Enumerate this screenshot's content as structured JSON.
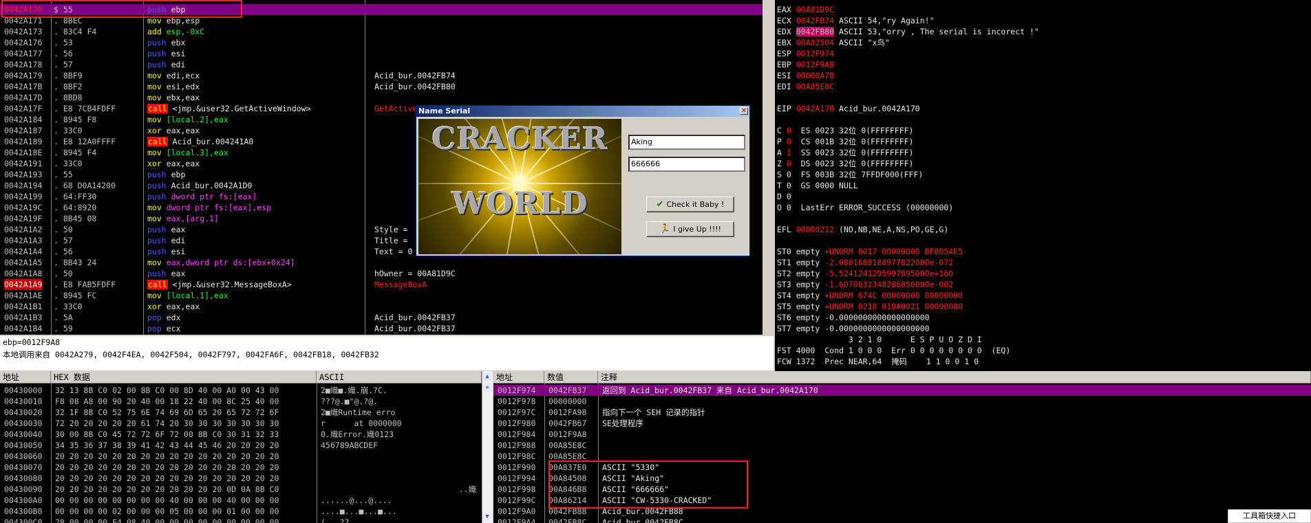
{
  "disasm": {
    "rows": [
      {
        "addr": "0042A170",
        "hex": "$ 55",
        "code": "push ebp",
        "cmt": ""
      },
      {
        "addr": "0042A171",
        "hex": ". 8BEC",
        "code": "mov ebp,esp",
        "cmt": ""
      },
      {
        "addr": "0042A173",
        "hex": ". 83C4 F4",
        "code": "add esp,-0xC",
        "cmt": ""
      },
      {
        "addr": "0042A176",
        "hex": ". 53",
        "code": "push ebx",
        "cmt": ""
      },
      {
        "addr": "0042A177",
        "hex": ". 56",
        "code": "push esi",
        "cmt": ""
      },
      {
        "addr": "0042A178",
        "hex": ". 57",
        "code": "push edi",
        "cmt": ""
      },
      {
        "addr": "0042A179",
        "hex": ". 8BF9",
        "code": "mov edi,ecx",
        "cmt": "Acid_bur.0042FB74"
      },
      {
        "addr": "0042A17B",
        "hex": ". 8BF2",
        "code": "mov esi,edx",
        "cmt": "Acid_bur.0042FB80"
      },
      {
        "addr": "0042A17D",
        "hex": ". 8BD8",
        "code": "mov ebx,eax",
        "cmt": ""
      },
      {
        "addr": "0042A17F",
        "hex": ". E8 7CB4FDFF",
        "code": "call <jmp.&user32.GetActiveWindow>",
        "cmt": "GetActiveWindow"
      },
      {
        "addr": "0042A184",
        "hex": ". 8945 F8",
        "code": "mov [local.2],eax",
        "cmt": ""
      },
      {
        "addr": "0042A187",
        "hex": ". 33C0",
        "code": "xor eax,eax",
        "cmt": ""
      },
      {
        "addr": "0042A189",
        "hex": ". E8 12A0FFFF",
        "code": "call Acid_bur.004241A0",
        "cmt": ""
      },
      {
        "addr": "0042A18E",
        "hex": ". 8945 F4",
        "code": "mov [local.3],eax",
        "cmt": ""
      },
      {
        "addr": "0042A191",
        "hex": ". 33C0",
        "code": "xor eax,eax",
        "cmt": ""
      },
      {
        "addr": "0042A193",
        "hex": ". 55",
        "code": "push ebp",
        "cmt": ""
      },
      {
        "addr": "0042A194",
        "hex": ". 68 D0A14200",
        "code": "push Acid_bur.0042A1D0",
        "cmt": ""
      },
      {
        "addr": "0042A199",
        "hex": ". 64:FF30",
        "code": "push dword ptr fs:[eax]",
        "cmt": ""
      },
      {
        "addr": "0042A19C",
        "hex": ". 64:8920",
        "code": "mov dword ptr fs:[eax],esp",
        "cmt": ""
      },
      {
        "addr": "0042A19F",
        "hex": ". 8B45 08",
        "code": "mov eax,[arg.1]",
        "cmt": ""
      },
      {
        "addr": "0042A1A2",
        "hex": ". 50",
        "code": "push eax",
        "cmt": "Style ="
      },
      {
        "addr": "0042A1A3",
        "hex": ". 57",
        "code": "push edi",
        "cmt": "Title ="
      },
      {
        "addr": "0042A1A4",
        "hex": ". 56",
        "code": "push esi",
        "cmt": "Text = 0"
      },
      {
        "addr": "0042A1A5",
        "hex": ". 8B43 24",
        "code": "mov eax,dword ptr ds:[ebx+0x24]",
        "cmt": ""
      },
      {
        "addr": "0042A1A8",
        "hex": ". 50",
        "code": "push eax",
        "cmt": "hOwner = 00A81D9C"
      },
      {
        "addr": "0042A1A9",
        "hex": ". E8 FAB5FDFF",
        "code": "call <jmp.&user32.MessageBoxA>",
        "cmt": "MessageBoxA"
      },
      {
        "addr": "0042A1AE",
        "hex": ". 8945 FC",
        "code": "mov [local.1],eax",
        "cmt": ""
      },
      {
        "addr": "0042A1B1",
        "hex": ". 33C0",
        "code": "xor eax,eax",
        "cmt": ""
      },
      {
        "addr": "0042A1B3",
        "hex": ". 5A",
        "code": "pop edx",
        "cmt": "Acid_bur.0042FB37"
      },
      {
        "addr": "0042A1B4",
        "hex": ". 59",
        "code": "pop ecx",
        "cmt": "Acid_bur.0042FB37"
      }
    ]
  },
  "info": {
    "line1": "ebp=0012F9A8",
    "line2": "本地调用来自 0042A279, 0042F4EA, 0042F504, 0042F797, 0042FA6F, 0042FB18, 0042FB32"
  },
  "registers": {
    "gp": [
      {
        "name": "EAX",
        "val": "00A81D9C",
        "note": ""
      },
      {
        "name": "ECX",
        "val": "0042FB74",
        "note": "ASCII 54,\"ry Again!\""
      },
      {
        "name": "EDX",
        "val": "0042FB80",
        "note": "ASCII 53,\"orry , The serial is incorect !\""
      },
      {
        "name": "EBX",
        "val": "00A82504",
        "note": "ASCII \"x鸟\""
      },
      {
        "name": "ESP",
        "val": "0012F974",
        "note": ""
      },
      {
        "name": "EBP",
        "val": "0012F9A8",
        "note": ""
      },
      {
        "name": "ESI",
        "val": "00000A78",
        "note": ""
      },
      {
        "name": "EDI",
        "val": "00A85E8C",
        "note": ""
      }
    ],
    "eip": {
      "name": "EIP",
      "val": "0042A170",
      "note": "Acid_bur.0042A170"
    },
    "flags": [
      {
        "f": "C",
        "v": "0",
        "seg": "ES 0023 32位 0(FFFFFFFF)"
      },
      {
        "f": "P",
        "v": "0",
        "seg": "CS 001B 32位 0(FFFFFFFF)"
      },
      {
        "f": "A",
        "v": "1",
        "seg": "SS 0023 32位 0(FFFFFFFF)"
      },
      {
        "f": "Z",
        "v": "0",
        "seg": "DS 0023 32位 0(FFFFFFFF)"
      },
      {
        "f": "S",
        "v": "0",
        "seg": "FS 003B 32位 7FFDF000(FFF)"
      },
      {
        "f": "T",
        "v": "0",
        "seg": "GS 0000 NULL"
      },
      {
        "f": "D",
        "v": "0",
        "seg": ""
      },
      {
        "f": "O",
        "v": "0",
        "seg": "LastErr ERROR_SUCCESS (00000000)"
      }
    ],
    "efl": {
      "name": "EFL",
      "val": "00000212",
      "note": "(NO,NB,NE,A,NS,PO,GE,G)"
    },
    "fpu": [
      {
        "name": "ST0",
        "tag": "empty",
        "val": "+UNORM 0017 00000000 BF8054E5"
      },
      {
        "name": "ST1",
        "tag": "empty",
        "val": "-2.0801688188977822000e-072"
      },
      {
        "name": "ST2",
        "tag": "empty",
        "val": "-5.5241241295997895000e+160"
      },
      {
        "name": "ST3",
        "tag": "empty",
        "val": "-1.6070632348286856000e-002"
      },
      {
        "name": "ST4",
        "tag": "empty",
        "val": "+UNORM 674C 00000000 00000000"
      },
      {
        "name": "ST5",
        "tag": "empty",
        "val": "+UNORM 0218 018A0021 00000080"
      },
      {
        "name": "ST6",
        "tag": "empty",
        "val": "-0.0000000000000000000"
      },
      {
        "name": "ST7",
        "tag": "empty",
        "val": "-0.0000000000000000000"
      }
    ],
    "fpu_hdr": "               3 2 1 0      E S P U O Z D I",
    "fst": "FST 4000  Cond 1 0 0 0  Err 0 0 0 0 0 0 0 0  (EQ)",
    "fcw": "FCW 1372  Prec NEAR,64  掩码    1 1 0 0 1 0"
  },
  "dump": {
    "headers": {
      "addr": "地址",
      "hex": "HEX 数据",
      "ascii": "ASCII"
    },
    "rows": [
      {
        "addr": "00430000",
        "hex": "32 13 8B C0 02 00 8B C0 00 8D 40 00 A0 00 43 00",
        "ascii": "2■嬂■.嬂.崩.?C."
      },
      {
        "addr": "00430010",
        "hex": "F8 08 A8 00 90 20 40 00 18 22 40 00 8C 25 40 00",
        "ascii": "???@.■\"@.?@."
      },
      {
        "addr": "00430020",
        "hex": "32 1F 8B C0 52 75 6E 74 69 6D 65 20 65 72 72 6F",
        "ascii": "2■嬂Runtime erro"
      },
      {
        "addr": "00430030",
        "hex": "72 20 20 20 20 20 61 74 20 30 30 30 30 30 30 30",
        "ascii": "r      at 0000000"
      },
      {
        "addr": "00430040",
        "hex": "30 00 8B C0 45 72 72 6F 72 00 8B C0 30 31 32 33",
        "ascii": "0.嬂Error.嬂0123"
      },
      {
        "addr": "00430050",
        "hex": "34 35 36 37 38 39 41 42 43 44 45 46 20 20 20 20",
        "ascii": "456789ABCDEF"
      },
      {
        "addr": "00430060",
        "hex": "20 20 20 20 20 20 20 20 20 20 20 20 20 20 20 20",
        "ascii": ""
      },
      {
        "addr": "00430070",
        "hex": "20 20 20 20 20 20 20 20 20 20 20 20 20 20 20 20",
        "ascii": ""
      },
      {
        "addr": "00430080",
        "hex": "20 20 20 20 20 20 20 20 20 20 20 20 20 20 20 20",
        "ascii": ""
      },
      {
        "addr": "00430090",
        "hex": "20 20 20 20 20 20 20 20 20 20 20 20 0D 0A 8B C0",
        "ascii": "              ..嬂"
      },
      {
        "addr": "004300A0",
        "hex": "00 00 00 00 00 00 00 00 40 00 00 00 40 00 00 00",
        "ascii": "......@...@...."
      },
      {
        "addr": "004300B0",
        "hex": "00 00 00 00 02 00 00 00 05 00 00 00 01 00 00 00",
        "ascii": "....■...■...■..."
      },
      {
        "addr": "004300C0",
        "hex": "28 00 00 00 F4 08 40 00 00 00 00 00 00 00 00 00",
        "ascii": "(...??"
      }
    ]
  },
  "stack": {
    "headers": {
      "addr": "地址",
      "val": "数值",
      "cmt": "注释"
    },
    "rows": [
      {
        "addr": "0012F974",
        "val": "0042FB37",
        "cmt": "返回到 Acid_bur.0042FB37 来自 Acid_bur.0042A170"
      },
      {
        "addr": "0012F978",
        "val": "00000000",
        "cmt": ""
      },
      {
        "addr": "0012F97C",
        "val": "0012FA98",
        "cmt": "指向下一个 SEH 记录的指针"
      },
      {
        "addr": "0012F980",
        "val": "0042FB67",
        "cmt": "SE处理程序"
      },
      {
        "addr": "0012F984",
        "val": "0012F9A8",
        "cmt": ""
      },
      {
        "addr": "0012F988",
        "val": "00A85E8C",
        "cmt": ""
      },
      {
        "addr": "0012F98C",
        "val": "00A85E8C",
        "cmt": ""
      },
      {
        "addr": "0012F990",
        "val": "00A837E0",
        "cmt": "ASCII \"5330\""
      },
      {
        "addr": "0012F994",
        "val": "00A84508",
        "cmt": "ASCII \"Aking\""
      },
      {
        "addr": "0012F998",
        "val": "00A846B8",
        "cmt": "ASCII \"666666\""
      },
      {
        "addr": "0012F99C",
        "val": "00A86214",
        "cmt": "ASCII \"CW-5330-CRACKED\""
      },
      {
        "addr": "0012F9A0",
        "val": "0042FB88",
        "cmt": "Acid_bur.0042FB88"
      },
      {
        "addr": "0012F9A4",
        "val": "0042FB8C",
        "cmt": "Acid_bur.0042FB8C"
      }
    ]
  },
  "dialog": {
    "title": "Name Serial",
    "logo_top": "CRACKER",
    "logo_bottom": "WORLD",
    "name_value": "Aking",
    "serial_value": "666666",
    "check_label": "Check it Baby !",
    "giveup_label": "I give Up !!!!"
  },
  "taskbar": {
    "toolbox": "工具箱快捷入口"
  },
  "colors": {
    "selection": "#800080",
    "register_changed": "#ff2020",
    "annotation": "#ff2020",
    "keyword": "#4060ff",
    "call": "#ff0000"
  }
}
